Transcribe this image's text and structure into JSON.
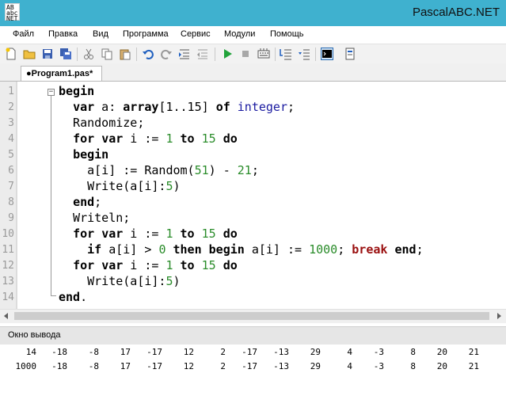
{
  "window": {
    "title": "PascalABC.NET",
    "logo_text": "AB\nabc\nNET"
  },
  "menu": [
    "Файл",
    "Правка",
    "Вид",
    "Программа",
    "Сервис",
    "Модули",
    "Помощь"
  ],
  "toolbar": {
    "icons": [
      "new-file-icon",
      "open-folder-icon",
      "save-icon",
      "save-all-icon",
      "cut-icon",
      "copy-icon",
      "paste-icon",
      "undo-icon",
      "redo-icon",
      "indent-icon",
      "outdent-icon",
      "run-icon",
      "stop-icon",
      "compile-icon",
      "step-over-icon",
      "step-into-icon",
      "output-window-icon",
      "form-designer-icon"
    ]
  },
  "tab": {
    "label": "●Program1.pas*"
  },
  "editor": {
    "line_numbers": [
      "1",
      "2",
      "3",
      "4",
      "5",
      "6",
      "7",
      "8",
      "9",
      "10",
      "11",
      "12",
      "13",
      "14"
    ],
    "lines": [
      [
        {
          "t": "begin",
          "c": "kw"
        }
      ],
      [
        {
          "t": "  "
        },
        {
          "t": "var",
          "c": "kw"
        },
        {
          "t": " a: "
        },
        {
          "t": "array",
          "c": "kw"
        },
        {
          "t": "[1..15] "
        },
        {
          "t": "of",
          "c": "kw"
        },
        {
          "t": " "
        },
        {
          "t": "integer",
          "c": "ty"
        },
        {
          "t": ";"
        }
      ],
      [
        {
          "t": "  Randomize;"
        }
      ],
      [
        {
          "t": "  "
        },
        {
          "t": "for",
          "c": "kw"
        },
        {
          "t": " "
        },
        {
          "t": "var",
          "c": "kw"
        },
        {
          "t": " i := "
        },
        {
          "t": "1",
          "c": "num"
        },
        {
          "t": " "
        },
        {
          "t": "to",
          "c": "kw"
        },
        {
          "t": " "
        },
        {
          "t": "15",
          "c": "num"
        },
        {
          "t": " "
        },
        {
          "t": "do",
          "c": "kw"
        }
      ],
      [
        {
          "t": "  "
        },
        {
          "t": "begin",
          "c": "kw"
        }
      ],
      [
        {
          "t": "    a[i] := Random("
        },
        {
          "t": "51",
          "c": "num"
        },
        {
          "t": ") - "
        },
        {
          "t": "21",
          "c": "num"
        },
        {
          "t": ";"
        }
      ],
      [
        {
          "t": "    Write(a[i]:"
        },
        {
          "t": "5",
          "c": "num"
        },
        {
          "t": ")"
        }
      ],
      [
        {
          "t": "  "
        },
        {
          "t": "end",
          "c": "kw"
        },
        {
          "t": ";"
        }
      ],
      [
        {
          "t": "  Writeln;"
        }
      ],
      [
        {
          "t": "  "
        },
        {
          "t": "for",
          "c": "kw"
        },
        {
          "t": " "
        },
        {
          "t": "var",
          "c": "kw"
        },
        {
          "t": " i := "
        },
        {
          "t": "1",
          "c": "num"
        },
        {
          "t": " "
        },
        {
          "t": "to",
          "c": "kw"
        },
        {
          "t": " "
        },
        {
          "t": "15",
          "c": "num"
        },
        {
          "t": " "
        },
        {
          "t": "do",
          "c": "kw"
        }
      ],
      [
        {
          "t": "    "
        },
        {
          "t": "if",
          "c": "kw"
        },
        {
          "t": " a[i] > "
        },
        {
          "t": "0",
          "c": "num"
        },
        {
          "t": " "
        },
        {
          "t": "then",
          "c": "kw"
        },
        {
          "t": " "
        },
        {
          "t": "begin",
          "c": "kw"
        },
        {
          "t": " a[i] := "
        },
        {
          "t": "1000",
          "c": "num"
        },
        {
          "t": "; "
        },
        {
          "t": "break",
          "c": "brk"
        },
        {
          "t": " "
        },
        {
          "t": "end",
          "c": "kw"
        },
        {
          "t": ";"
        }
      ],
      [
        {
          "t": "  "
        },
        {
          "t": "for",
          "c": "kw"
        },
        {
          "t": " "
        },
        {
          "t": "var",
          "c": "kw"
        },
        {
          "t": " i := "
        },
        {
          "t": "1",
          "c": "num"
        },
        {
          "t": " "
        },
        {
          "t": "to",
          "c": "kw"
        },
        {
          "t": " "
        },
        {
          "t": "15",
          "c": "num"
        },
        {
          "t": " "
        },
        {
          "t": "do",
          "c": "kw"
        }
      ],
      [
        {
          "t": "    Write(a[i]:"
        },
        {
          "t": "5",
          "c": "num"
        },
        {
          "t": ")"
        }
      ],
      [
        {
          "t": "end",
          "c": "kw"
        },
        {
          "t": "."
        }
      ]
    ]
  },
  "output": {
    "title": "Окно вывода",
    "rows": [
      [
        "14",
        "-18",
        "-8",
        "17",
        "-17",
        "12",
        "2",
        "-17",
        "-13",
        "29",
        "4",
        "-3",
        "8",
        "20",
        "21"
      ],
      [
        "1000",
        "-18",
        "-8",
        "17",
        "-17",
        "12",
        "2",
        "-17",
        "-13",
        "29",
        "4",
        "-3",
        "8",
        "20",
        "21"
      ]
    ]
  },
  "colors": {
    "titlebar": "#3fb1cf",
    "keyword": "#000000",
    "number": "#2a8c2a",
    "type": "#1a1aa0",
    "break": "#9a1010",
    "line_number": "#9a9a9a"
  }
}
